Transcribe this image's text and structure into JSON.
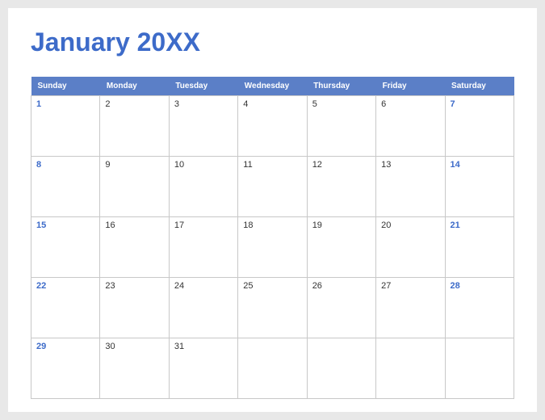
{
  "title": "January 20XX",
  "colors": {
    "accent": "#3d6bc9",
    "headerBg": "#5b7fc7",
    "border": "#c8c8c8"
  },
  "days": [
    "Sunday",
    "Monday",
    "Tuesday",
    "Wednesday",
    "Thursday",
    "Friday",
    "Saturday"
  ],
  "weeks": [
    [
      {
        "n": "1",
        "weekend": true
      },
      {
        "n": "2",
        "weekend": false
      },
      {
        "n": "3",
        "weekend": false
      },
      {
        "n": "4",
        "weekend": false
      },
      {
        "n": "5",
        "weekend": false
      },
      {
        "n": "6",
        "weekend": false
      },
      {
        "n": "7",
        "weekend": true
      }
    ],
    [
      {
        "n": "8",
        "weekend": true
      },
      {
        "n": "9",
        "weekend": false
      },
      {
        "n": "10",
        "weekend": false
      },
      {
        "n": "11",
        "weekend": false
      },
      {
        "n": "12",
        "weekend": false
      },
      {
        "n": "13",
        "weekend": false
      },
      {
        "n": "14",
        "weekend": true
      }
    ],
    [
      {
        "n": "15",
        "weekend": true
      },
      {
        "n": "16",
        "weekend": false
      },
      {
        "n": "17",
        "weekend": false
      },
      {
        "n": "18",
        "weekend": false
      },
      {
        "n": "19",
        "weekend": false
      },
      {
        "n": "20",
        "weekend": false
      },
      {
        "n": "21",
        "weekend": true
      }
    ],
    [
      {
        "n": "22",
        "weekend": true
      },
      {
        "n": "23",
        "weekend": false
      },
      {
        "n": "24",
        "weekend": false
      },
      {
        "n": "25",
        "weekend": false
      },
      {
        "n": "26",
        "weekend": false
      },
      {
        "n": "27",
        "weekend": false
      },
      {
        "n": "28",
        "weekend": true
      }
    ],
    [
      {
        "n": "29",
        "weekend": true
      },
      {
        "n": "30",
        "weekend": false
      },
      {
        "n": "31",
        "weekend": false
      },
      {
        "n": "",
        "weekend": false
      },
      {
        "n": "",
        "weekend": false
      },
      {
        "n": "",
        "weekend": false
      },
      {
        "n": "",
        "weekend": true
      }
    ]
  ]
}
